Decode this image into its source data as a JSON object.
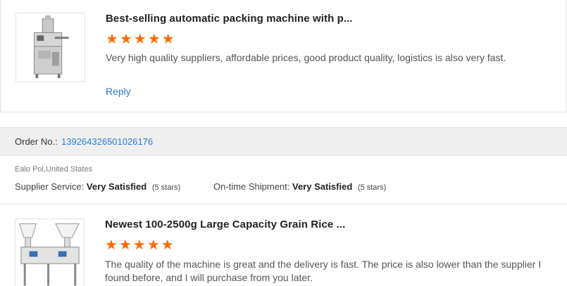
{
  "review_1": {
    "product_title": "Best-selling automatic packing machine with p...",
    "stars": 5,
    "text": "Very high quality suppliers, affordable prices, good product quality, logistics is also very fast.",
    "reply_label": "Reply"
  },
  "order": {
    "label": "Order No.:",
    "number": "139264326501026176",
    "buyer": "Ealo Pol,United States",
    "supplier_service_label": "Supplier Service:",
    "supplier_service_value": "Very Satisfied",
    "supplier_service_stars": "(5 stars)",
    "shipment_label": "On-time Shipment:",
    "shipment_value": "Very Satisfied",
    "shipment_stars": "(5 stars)"
  },
  "review_2": {
    "product_title": "Newest 100-2500g Large Capacity Grain Rice ...",
    "stars": 5,
    "text": "The quality of the machine is great and the delivery is fast. The price is also lower than the supplier I found before, and I will purchase from you later."
  },
  "colors": {
    "star": "#ff6a00",
    "link": "#2c7ad6",
    "orderbar": "#efefef"
  }
}
